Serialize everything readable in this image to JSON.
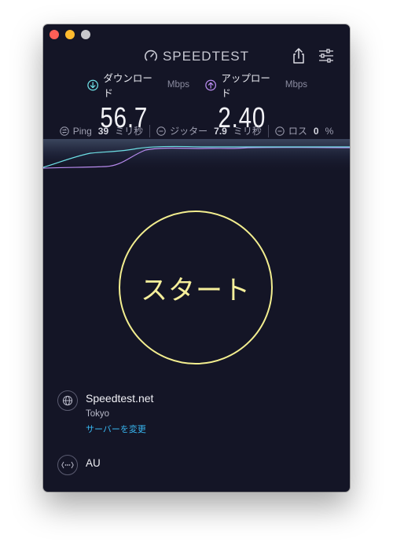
{
  "app": {
    "brand": "SPEEDTEST",
    "colors": {
      "background": "#141526",
      "accent_start": "#f3ee8f",
      "download": "#6ee0e6",
      "upload": "#b98cf0",
      "link": "#38b6f0"
    }
  },
  "results": {
    "download": {
      "label": "ダウンロード",
      "unit": "Mbps",
      "value": "56.7",
      "icon": "download-arrow-icon"
    },
    "upload": {
      "label": "アップロード",
      "unit": "Mbps",
      "value": "2.40",
      "icon": "upload-arrow-icon"
    }
  },
  "stats": {
    "ping": {
      "label": "Ping",
      "value": "39",
      "unit": "ミリ秒"
    },
    "jitter": {
      "label": "ジッター",
      "value": "7.9",
      "unit": "ミリ秒"
    },
    "loss": {
      "label": "ロス",
      "value": "0",
      "unit": "%"
    }
  },
  "start": {
    "label": "スタート"
  },
  "server": {
    "name": "Speedtest.net",
    "location": "Tokyo",
    "change_label": "サーバーを変更"
  },
  "isp": {
    "name": "AU"
  }
}
